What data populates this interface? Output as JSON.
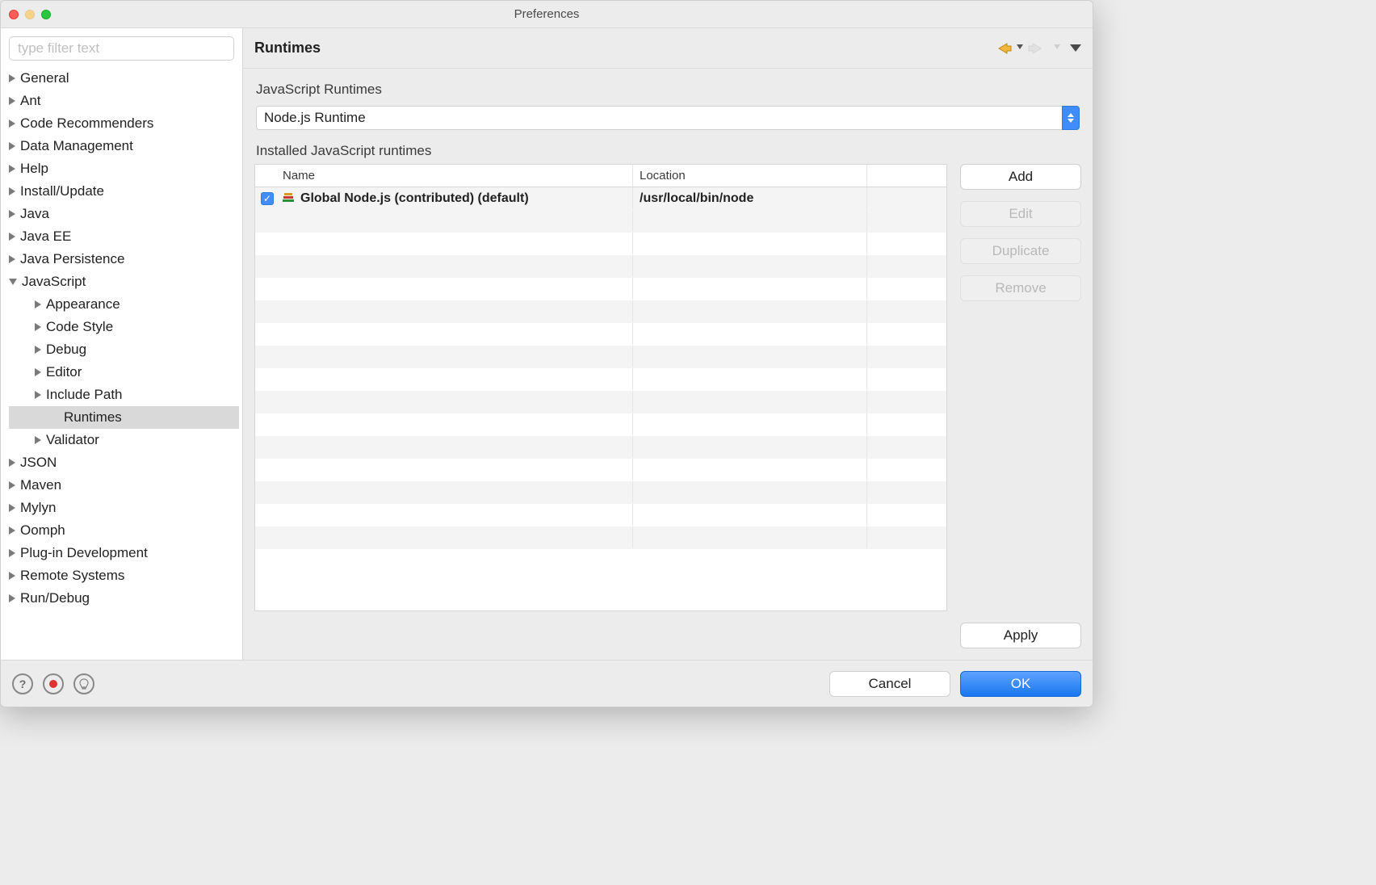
{
  "window": {
    "title": "Preferences"
  },
  "filter": {
    "placeholder": "type filter text"
  },
  "tree": [
    {
      "label": "General",
      "expand": "right",
      "indent": 0
    },
    {
      "label": "Ant",
      "expand": "right",
      "indent": 0
    },
    {
      "label": "Code Recommenders",
      "expand": "right",
      "indent": 0
    },
    {
      "label": "Data Management",
      "expand": "right",
      "indent": 0
    },
    {
      "label": "Help",
      "expand": "right",
      "indent": 0
    },
    {
      "label": "Install/Update",
      "expand": "right",
      "indent": 0
    },
    {
      "label": "Java",
      "expand": "right",
      "indent": 0
    },
    {
      "label": "Java EE",
      "expand": "right",
      "indent": 0
    },
    {
      "label": "Java Persistence",
      "expand": "right",
      "indent": 0
    },
    {
      "label": "JavaScript",
      "expand": "down",
      "indent": 0
    },
    {
      "label": "Appearance",
      "expand": "right",
      "indent": 1
    },
    {
      "label": "Code Style",
      "expand": "right",
      "indent": 1
    },
    {
      "label": "Debug",
      "expand": "right",
      "indent": 1
    },
    {
      "label": "Editor",
      "expand": "right",
      "indent": 1
    },
    {
      "label": "Include Path",
      "expand": "right",
      "indent": 1
    },
    {
      "label": "Runtimes",
      "expand": "none",
      "indent": 2,
      "selected": true
    },
    {
      "label": "Validator",
      "expand": "right",
      "indent": 1
    },
    {
      "label": "JSON",
      "expand": "right",
      "indent": 0
    },
    {
      "label": "Maven",
      "expand": "right",
      "indent": 0
    },
    {
      "label": "Mylyn",
      "expand": "right",
      "indent": 0
    },
    {
      "label": "Oomph",
      "expand": "right",
      "indent": 0
    },
    {
      "label": "Plug-in Development",
      "expand": "right",
      "indent": 0
    },
    {
      "label": "Remote Systems",
      "expand": "right",
      "indent": 0
    },
    {
      "label": "Run/Debug",
      "expand": "right",
      "indent": 0
    }
  ],
  "main": {
    "title": "Runtimes",
    "section": "JavaScript Runtimes",
    "combo_value": "Node.js Runtime",
    "table_header": "Installed JavaScript runtimes",
    "columns": {
      "name": "Name",
      "location": "Location"
    },
    "rows": [
      {
        "checked": true,
        "name": "Global Node.js (contributed) (default)",
        "location": "/usr/local/bin/node"
      }
    ],
    "empty_row_count": 15,
    "buttons": {
      "add": "Add",
      "edit": "Edit",
      "duplicate": "Duplicate",
      "remove": "Remove",
      "apply": "Apply"
    }
  },
  "footer": {
    "cancel": "Cancel",
    "ok": "OK"
  }
}
